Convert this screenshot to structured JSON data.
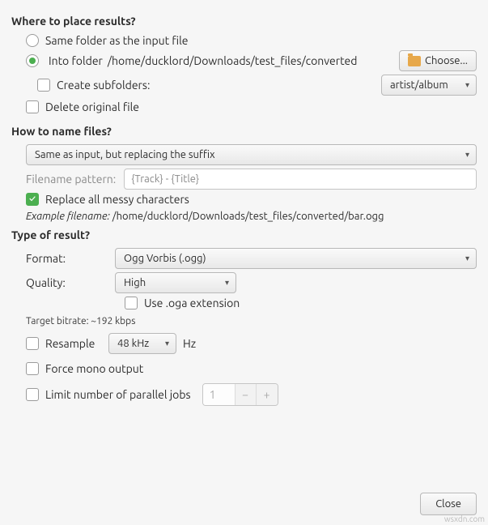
{
  "sections": {
    "place": "Where to place results?",
    "name": "How to name files?",
    "type": "Type of result?"
  },
  "place": {
    "same_folder": "Same folder as the input file",
    "into_folder_prefix": "Into folder",
    "into_folder_path": "/home/ducklord/Downloads/test_files/converted",
    "choose": "Choose...",
    "create_subfolders": "Create subfolders:",
    "subfolder_pattern": "artist/album",
    "delete_original": "Delete original file"
  },
  "naming": {
    "mode": "Same as input, but replacing the suffix",
    "pattern_label": "Filename pattern:",
    "pattern_placeholder": "{Track} - {Title}",
    "replace_messy": "Replace all messy characters",
    "example_label": "Example filename:",
    "example_value": "/home/ducklord/Downloads/test_files/converted/bar.ogg"
  },
  "type": {
    "format_label": "Format:",
    "format_value": "Ogg Vorbis (.ogg)",
    "quality_label": "Quality:",
    "quality_value": "High",
    "oga": "Use .oga extension",
    "bitrate": "Target bitrate: ~192 kbps",
    "resample": "Resample",
    "resample_value": "48 kHz",
    "hz": "Hz",
    "mono": "Force mono output",
    "parallel": "Limit number of parallel jobs",
    "parallel_value": "1"
  },
  "footer": {
    "close": "Close"
  },
  "watermark": "wsxdn.com"
}
